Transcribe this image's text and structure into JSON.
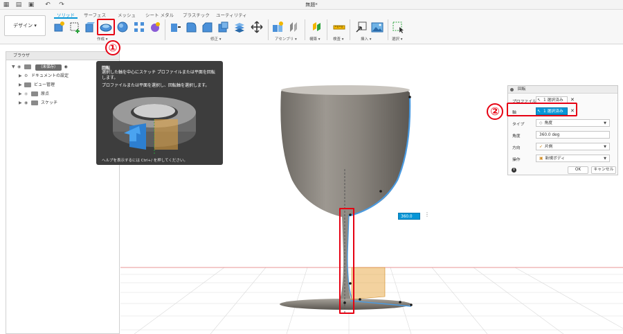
{
  "window": {
    "title": "無題*"
  },
  "workspace": {
    "label": "デザイン ▾"
  },
  "tabs": [
    {
      "label": "ソリッド"
    },
    {
      "label": "サーフェス"
    },
    {
      "label": "メッシュ"
    },
    {
      "label": "シート メタル"
    },
    {
      "label": "プラスチック"
    },
    {
      "label": "ユーティリティ"
    }
  ],
  "toolbar_groups": [
    {
      "label": "作成 ▾"
    },
    {
      "label": "修正 ▾"
    },
    {
      "label": "アセンブリ ▾"
    },
    {
      "label": "構築 ▾"
    },
    {
      "label": "検査 ▾"
    },
    {
      "label": "挿入 ▾"
    },
    {
      "label": "選択 ▾"
    }
  ],
  "browser": {
    "title": "ブラウザ",
    "root": {
      "badge": "（未保存）"
    },
    "items": [
      {
        "label": "ドキュメントの設定"
      },
      {
        "label": "ビュー管理"
      },
      {
        "label": "原点"
      },
      {
        "label": "スケッチ"
      }
    ]
  },
  "tooltip": {
    "title": "回転",
    "description1": "選択した軸を中心にスケッチ プロファイルまたは平面を回転します。",
    "description2": "プロファイルまたは平面を選択し、回転軸を選択します。",
    "help": "ヘルプを表示するには Ctrl+/ を押してください。"
  },
  "callouts": {
    "one": "①",
    "two": "②"
  },
  "revolve_panel": {
    "title": "回転",
    "profile_label": "プロファイル",
    "profile_value": "1 選択済み",
    "axis_label": "軸",
    "axis_value": "1 選択済み",
    "type_label": "タイプ",
    "type_value": "角度",
    "angle_label": "角度",
    "angle_value": "360.0 deg",
    "direction_label": "方向",
    "direction_value": "片側",
    "operation_label": "操作",
    "operation_value": "新規ボディ",
    "ok_label": "OK",
    "cancel_label": "キャンセル",
    "clear_glyph": "✕"
  },
  "viewport": {
    "angle_readout": "360.0 deg"
  },
  "colors": {
    "accent": "#0696d7",
    "highlight": "#e60012",
    "body": "#8f8a82",
    "profile": "#e8a640"
  }
}
